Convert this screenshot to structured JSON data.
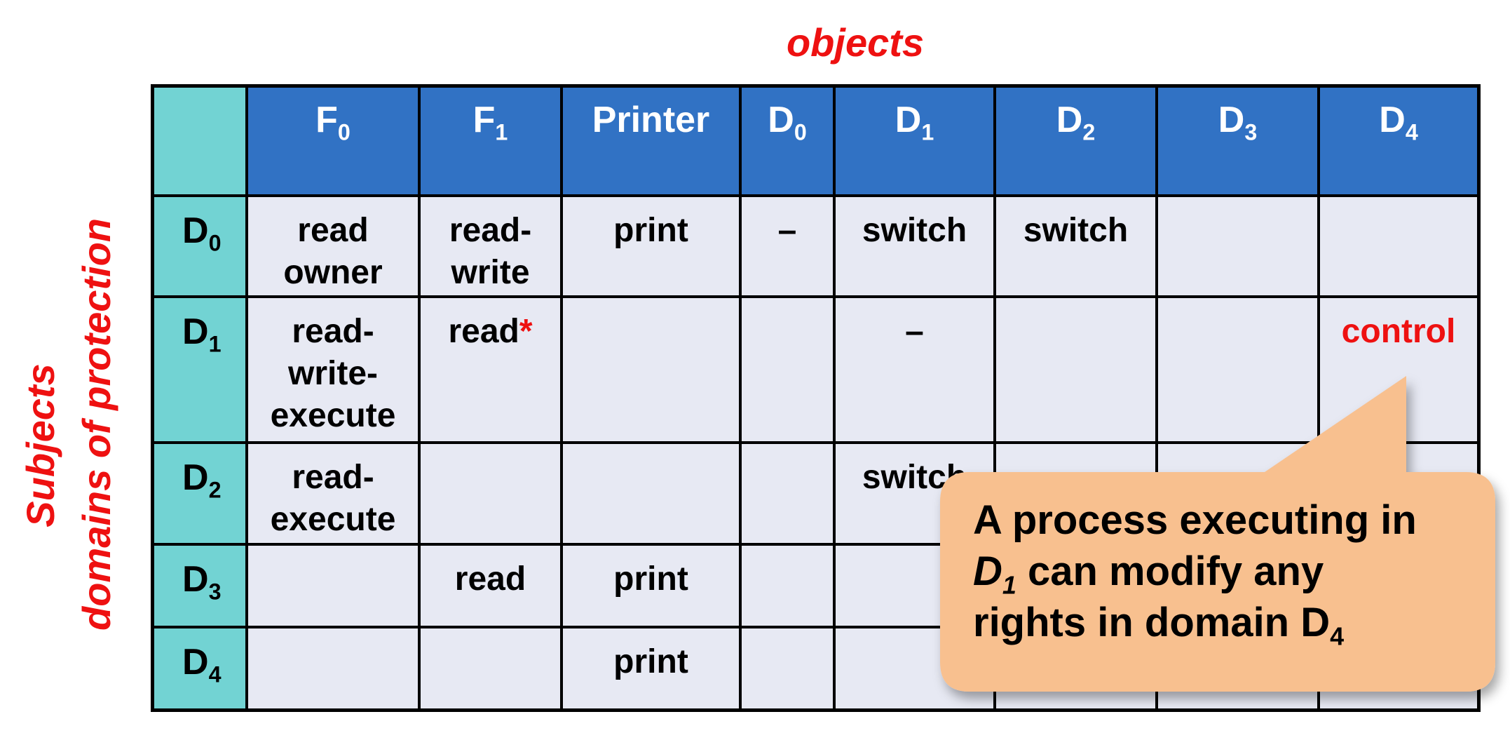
{
  "titles": {
    "objects": "objects",
    "subjects": "Subjects",
    "domains": "domains of protection"
  },
  "colors": {
    "title_red": "#ee1111",
    "header_blue": "#3172c4",
    "row_header_teal": "#72d3d3",
    "cell_bg": "#e7e9f3",
    "callout_bg": "#f8c08f"
  },
  "columns": [
    {
      "base": "F",
      "sub": "0"
    },
    {
      "base": "F",
      "sub": "1"
    },
    {
      "base": "Printer",
      "sub": ""
    },
    {
      "base": "D",
      "sub": "0"
    },
    {
      "base": "D",
      "sub": "1"
    },
    {
      "base": "D",
      "sub": "2"
    },
    {
      "base": "D",
      "sub": "3"
    },
    {
      "base": "D",
      "sub": "4"
    }
  ],
  "rows": [
    {
      "base": "D",
      "sub": "0",
      "cells": [
        [
          "read",
          "owner"
        ],
        [
          "read-",
          "write"
        ],
        [
          "print"
        ],
        [
          "–"
        ],
        [
          "switch"
        ],
        [
          "switch"
        ],
        [],
        []
      ]
    },
    {
      "base": "D",
      "sub": "1",
      "cells": [
        [
          "read-",
          "write-",
          "execute"
        ],
        [
          "read*"
        ],
        [],
        [],
        [
          "–"
        ],
        [],
        [],
        [
          "control"
        ]
      ]
    },
    {
      "base": "D",
      "sub": "2",
      "cells": [
        [
          "read-",
          "execute"
        ],
        [],
        [],
        [],
        [
          "switch"
        ],
        [],
        [],
        []
      ]
    },
    {
      "base": "D",
      "sub": "3",
      "cells": [
        [],
        [
          "read"
        ],
        [
          "print"
        ],
        [],
        [],
        [],
        [],
        []
      ]
    },
    {
      "base": "D",
      "sub": "4",
      "cells": [
        [],
        [],
        [
          "print"
        ],
        [],
        [],
        [],
        [],
        []
      ]
    }
  ],
  "highlights": {
    "asterisk_cell": "D1-F1",
    "red_cell": "D1-D4"
  },
  "callout": {
    "line1": "A process executing in",
    "line2_italic": "D",
    "line2_italic_sub": "1",
    "line2_rest": " can modify any",
    "line3": "rights in domain D",
    "line3_sub": "4"
  }
}
